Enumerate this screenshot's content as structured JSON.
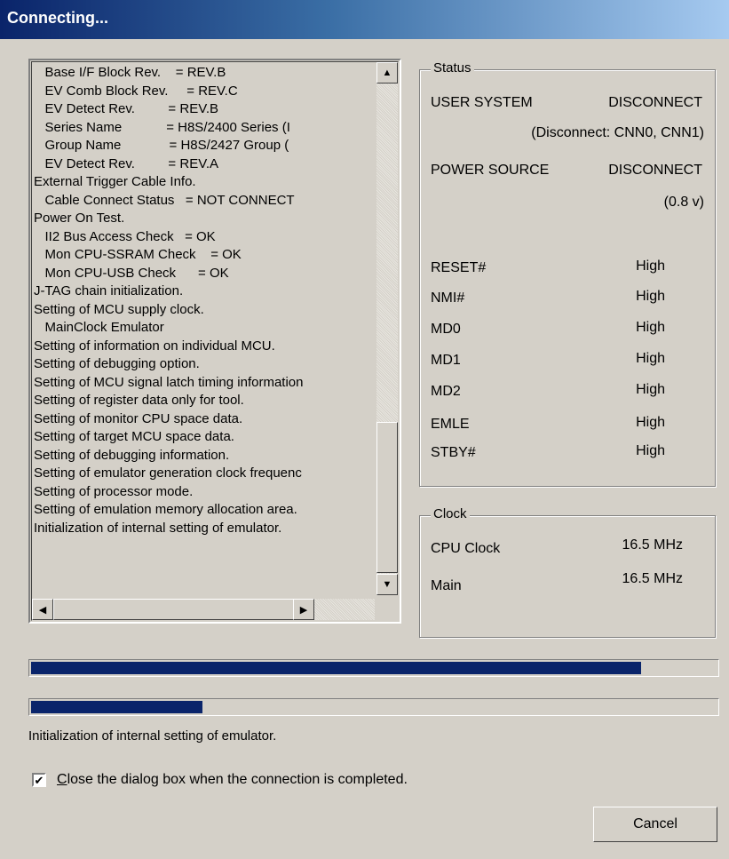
{
  "window": {
    "title": "Connecting..."
  },
  "log": {
    "lines": [
      "   Base I/F Block Rev.    = REV.B",
      "   EV Comb Block Rev.     = REV.C",
      "   EV Detect Rev.         = REV.B",
      "   Series Name            = H8S/2400 Series (I",
      "   Group Name             = H8S/2427 Group (",
      "   EV Detect Rev.         = REV.A",
      "External Trigger Cable Info.",
      "   Cable Connect Status   = NOT CONNECT",
      "Power On Test.",
      "   II2 Bus Access Check   = OK",
      "   Mon CPU-SSRAM Check    = OK",
      "   Mon CPU-USB Check      = OK",
      "J-TAG chain initialization.",
      "Setting of MCU supply clock.",
      "   MainClock Emulator",
      "Setting of information on individual MCU.",
      "Setting of debugging option.",
      "Setting of MCU signal latch timing information",
      "Setting of register data only for tool.",
      "Setting of monitor CPU space data.",
      "Setting of target MCU space data.",
      "Setting of debugging information.",
      "Setting of emulator generation clock frequenc",
      "Setting of processor mode.",
      "Setting of emulation memory allocation area.",
      "Initialization of internal setting of emulator."
    ]
  },
  "status_group": {
    "title": "Status",
    "user_system_label": "USER SYSTEM",
    "user_system_value": "DISCONNECT",
    "user_system_detail": "(Disconnect: CNN0, CNN1)",
    "power_source_label": "POWER SOURCE",
    "power_source_value": "DISCONNECT",
    "power_source_detail": "(0.8 v)",
    "signals": [
      {
        "name": "RESET#",
        "value": "High"
      },
      {
        "name": "NMI#",
        "value": "High"
      },
      {
        "name": "MD0",
        "value": "High"
      },
      {
        "name": "MD1",
        "value": "High"
      },
      {
        "name": "MD2",
        "value": "High"
      },
      {
        "name": "EMLE",
        "value": "High"
      },
      {
        "name": "STBY#",
        "value": "High"
      }
    ]
  },
  "clock_group": {
    "title": "Clock",
    "cpu_clock_label": "CPU Clock",
    "cpu_clock_value": "16.5 MHz",
    "main_label": "Main",
    "main_value": "16.5 MHz"
  },
  "progress": {
    "overall_fraction": 0.89,
    "step_fraction": 0.25
  },
  "status_message": "Initialization of internal setting of emulator.",
  "close_checkbox": {
    "checked": true,
    "label": "Close the dialog box when the connection is completed."
  },
  "buttons": {
    "cancel": "Cancel"
  },
  "colors": {
    "title_gradient_start": "#0a246a",
    "progress_fill": "#0a246a",
    "dialog_bg": "#d4d0c8"
  }
}
